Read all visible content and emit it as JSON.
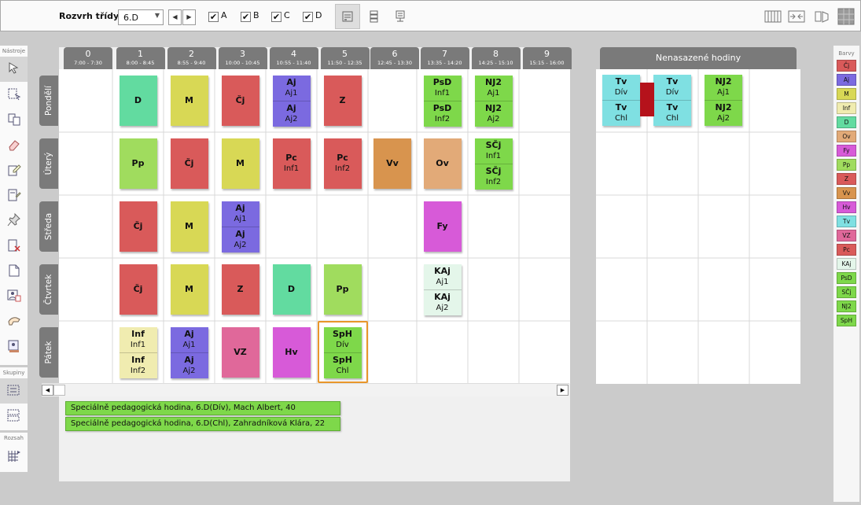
{
  "toolbar": {
    "class_label": "Rozvrh třídy:",
    "class_value": "6.D",
    "prev_icon": "triangle-left-icon",
    "next_icon": "triangle-right-icon",
    "checks": [
      {
        "label": "A",
        "checked": true
      },
      {
        "label": "B",
        "checked": true
      },
      {
        "label": "C",
        "checked": true
      },
      {
        "label": "D",
        "checked": true
      }
    ],
    "view_buttons": [
      "list-view-icon",
      "tree-view-icon",
      "print-layout-icon"
    ],
    "right_icons": [
      "columns-icon",
      "collapse-icon",
      "mirror-icon",
      "grid-icon"
    ]
  },
  "tools": {
    "title": "Nástroje",
    "items": [
      "pointer-icon",
      "select-icon",
      "swap-icon",
      "eraser-icon",
      "edit-icon",
      "card-edit-icon",
      "pin-icon",
      "delete-card-icon",
      "note-icon",
      "teacher-icon",
      "hand-icon",
      "image-icon"
    ]
  },
  "groups": {
    "title": "Skupiny",
    "items": [
      "group-split-icon",
      "group-merge-icon"
    ]
  },
  "range": {
    "title": "Rozsah",
    "items": [
      "range-icon"
    ]
  },
  "periods": [
    {
      "n": "0",
      "time": "7:00 - 7:30"
    },
    {
      "n": "1",
      "time": "8:00 - 8:45"
    },
    {
      "n": "2",
      "time": "8:55 - 9:40"
    },
    {
      "n": "3",
      "time": "10:00 - 10:45"
    },
    {
      "n": "4",
      "time": "10:55 - 11:40"
    },
    {
      "n": "5",
      "time": "11:50 - 12:35"
    },
    {
      "n": "6",
      "time": "12:45 - 13:30"
    },
    {
      "n": "7",
      "time": "13:35 - 14:20"
    },
    {
      "n": "8",
      "time": "14:25 - 15:10"
    },
    {
      "n": "9",
      "time": "15:15 - 16:00"
    }
  ],
  "days": [
    "Pondělí",
    "Úterý",
    "Středa",
    "Čtvrtek",
    "Pátek"
  ],
  "colors": {
    "Čj": "#d95a5a",
    "Aj": "#7b6ae0",
    "M": "#d8d855",
    "Inf": "#f0ecb0",
    "D": "#62dba0",
    "Ov": "#e2aa78",
    "Fy": "#d75ad8",
    "Pp": "#a0dc5e",
    "Z": "#d95a5a",
    "Vv": "#d8944e",
    "Hv": "#d75ad8",
    "Tv": "#7fe0e2",
    "VZ": "#e0689a",
    "Pc": "#d95a5a",
    "KAj": "#e4f6ea",
    "PsD": "#7ed84a",
    "SČj": "#7ed84a",
    "NJ2": "#7ed84a",
    "SpH": "#7ed84a"
  },
  "cards": [
    {
      "day": 0,
      "period": 1,
      "subject": "D"
    },
    {
      "day": 0,
      "period": 2,
      "subject": "M"
    },
    {
      "day": 0,
      "period": 3,
      "subject": "Čj"
    },
    {
      "day": 0,
      "period": 4,
      "subject": "Aj",
      "groups": [
        "Aj1",
        "Aj2"
      ]
    },
    {
      "day": 0,
      "period": 5,
      "subject": "Z"
    },
    {
      "day": 0,
      "period": 7,
      "subject": "PsD",
      "groups": [
        "Inf1",
        "Inf2"
      ]
    },
    {
      "day": 0,
      "period": 8,
      "subject": "NJ2",
      "groups": [
        "Aj1",
        "Aj2"
      ]
    },
    {
      "day": 1,
      "period": 1,
      "subject": "Pp"
    },
    {
      "day": 1,
      "period": 2,
      "subject": "Čj"
    },
    {
      "day": 1,
      "period": 3,
      "subject": "M"
    },
    {
      "day": 1,
      "period": 4,
      "subject": "Pc",
      "single_group": "Inf1"
    },
    {
      "day": 1,
      "period": 5,
      "subject": "Pc",
      "single_group": "Inf2"
    },
    {
      "day": 1,
      "period": 6,
      "subject": "Vv"
    },
    {
      "day": 1,
      "period": 7,
      "subject": "Ov"
    },
    {
      "day": 1,
      "period": 8,
      "subject": "SČj",
      "groups": [
        "Inf1",
        "Inf2"
      ]
    },
    {
      "day": 2,
      "period": 1,
      "subject": "Čj"
    },
    {
      "day": 2,
      "period": 2,
      "subject": "M"
    },
    {
      "day": 2,
      "period": 3,
      "subject": "Aj",
      "groups": [
        "Aj1",
        "Aj2"
      ]
    },
    {
      "day": 2,
      "period": 7,
      "subject": "Fy"
    },
    {
      "day": 3,
      "period": 1,
      "subject": "Čj"
    },
    {
      "day": 3,
      "period": 2,
      "subject": "M"
    },
    {
      "day": 3,
      "period": 3,
      "subject": "Z"
    },
    {
      "day": 3,
      "period": 4,
      "subject": "D"
    },
    {
      "day": 3,
      "period": 5,
      "subject": "Pp"
    },
    {
      "day": 3,
      "period": 7,
      "subject": "KAj",
      "groups": [
        "Aj1",
        "Aj2"
      ]
    },
    {
      "day": 4,
      "period": 1,
      "subject": "Inf",
      "groups": [
        "Inf1",
        "Inf2"
      ]
    },
    {
      "day": 4,
      "period": 2,
      "subject": "Aj",
      "groups": [
        "Aj1",
        "Aj2"
      ]
    },
    {
      "day": 4,
      "period": 3,
      "subject": "VZ"
    },
    {
      "day": 4,
      "period": 4,
      "subject": "Hv"
    },
    {
      "day": 4,
      "period": 5,
      "subject": "SpH",
      "groups": [
        "Dív",
        "Chl"
      ],
      "selected": true
    }
  ],
  "info_rows": [
    "Speciálně pedagogická hodina, 6.D(Dív), Mach Albert, 40",
    "Speciálně pedagogická hodina, 6.D(Chl), Zahradníková Klára, 22"
  ],
  "unplaced": {
    "title": "Nenasazené hodiny",
    "cards": [
      {
        "col": 0,
        "subject": "Tv",
        "groups": [
          "Dív",
          "Chl"
        ]
      },
      {
        "col": 1,
        "subject": "Tv",
        "groups": [
          "Dív",
          "Chl"
        ]
      },
      {
        "col": 2,
        "subject": "NJ2",
        "groups": [
          "Aj1",
          "Aj2"
        ]
      }
    ],
    "marker_color": "#b5121b"
  },
  "swatches": {
    "title": "Barvy",
    "items": [
      "Čj",
      "Aj",
      "M",
      "Inf",
      "D",
      "Ov",
      "Fy",
      "Pp",
      "Z",
      "Vv",
      "Hv",
      "Tv",
      "VZ",
      "Pc",
      "KAj",
      "PsD",
      "SČj",
      "NJ2",
      "SpH"
    ]
  }
}
